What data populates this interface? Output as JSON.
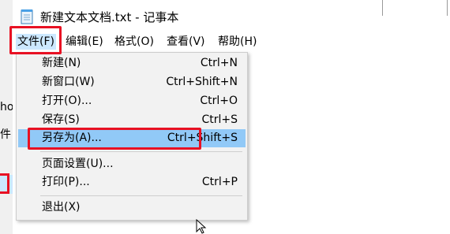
{
  "background_window": {
    "frag_top": "ho",
    "frag_bottom": "件"
  },
  "window": {
    "title": "新建文本文档.txt - 记事本",
    "icon": "notepad-icon"
  },
  "menubar": {
    "items": [
      {
        "label": "文件(F)"
      },
      {
        "label": "编辑(E)"
      },
      {
        "label": "格式(O)"
      },
      {
        "label": "查看(V)"
      },
      {
        "label": "帮助(H)"
      }
    ]
  },
  "file_menu": {
    "items": [
      {
        "label": "新建(N)",
        "shortcut": "Ctrl+N"
      },
      {
        "label": "新窗口(W)",
        "shortcut": "Ctrl+Shift+N"
      },
      {
        "label": "打开(O)...",
        "shortcut": "Ctrl+O"
      },
      {
        "label": "保存(S)",
        "shortcut": "Ctrl+S"
      },
      {
        "label": "另存为(A)...",
        "shortcut": "Ctrl+Shift+S"
      },
      {
        "label": "页面设置(U)...",
        "shortcut": ""
      },
      {
        "label": "打印(P)...",
        "shortcut": "Ctrl+P"
      },
      {
        "label": "退出(X)",
        "shortcut": ""
      }
    ]
  },
  "colors": {
    "highlight": "#91c9f7",
    "menu_active": "#cce8ff",
    "annotation": "#e81123"
  }
}
